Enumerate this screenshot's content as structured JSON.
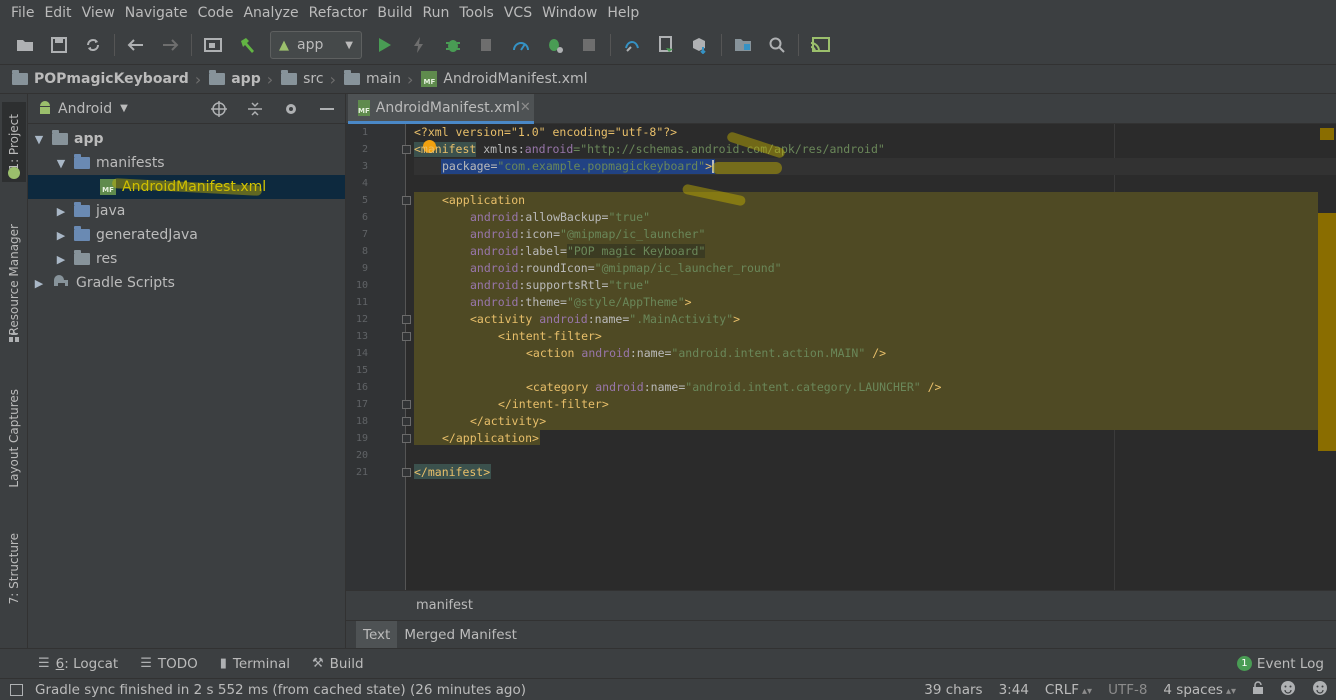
{
  "menu": [
    "File",
    "Edit",
    "View",
    "Navigate",
    "Code",
    "Analyze",
    "Refactor",
    "Build",
    "Run",
    "Tools",
    "VCS",
    "Window",
    "Help"
  ],
  "toolbar": {
    "run_config": "app"
  },
  "breadcrumb": {
    "project": "POPmagicKeyboard",
    "module": "app",
    "src": "src",
    "main": "main",
    "file": "AndroidManifest.xml"
  },
  "left_stripe": {
    "project": "1: Project",
    "resource_manager": "Resource Manager",
    "layout_captures": "Layout Captures",
    "structure": "7: Structure"
  },
  "project_panel": {
    "view_mode": "Android",
    "tree": {
      "app": "app",
      "manifests": "manifests",
      "manifest_file": "AndroidManifest.xml",
      "java": "java",
      "generated_java": "generatedJava",
      "res": "res",
      "gradle_scripts": "Gradle Scripts"
    }
  },
  "editor": {
    "tab_label": "AndroidManifest.xml",
    "line_numbers": [
      "1",
      "2",
      "3",
      "4",
      "5",
      "6",
      "7",
      "8",
      "9",
      "10",
      "11",
      "12",
      "13",
      "14",
      "15",
      "16",
      "17",
      "18",
      "19",
      "20",
      "21"
    ],
    "code": {
      "l1": "<?xml version=\"1.0\" encoding=\"utf-8\"?>",
      "l2_tag": "<manifest",
      "l2_ns": "xmlns:",
      "l2_attr": "android",
      "l2_val": "=\"http://schemas.android.com/apk/res/android\"",
      "l3_attr": "package=",
      "l3_val": "\"com.example.popmagickeyboard\"",
      "l3_end": ">",
      "l5": "<application",
      "l6_ns": "android",
      "l6_attr": ":allowBackup=",
      "l6_val": "\"true\"",
      "l7_ns": "android",
      "l7_attr": ":icon=",
      "l7_val": "\"@mipmap/ic_launcher\"",
      "l8_ns": "android",
      "l8_attr": ":label=",
      "l8_val": "\"POP magic Keyboard\"",
      "l9_ns": "android",
      "l9_attr": ":roundIcon=",
      "l9_val": "\"@mipmap/ic_launcher_round\"",
      "l10_ns": "android",
      "l10_attr": ":supportsRtl=",
      "l10_val": "\"true\"",
      "l11_ns": "android",
      "l11_attr": ":theme=",
      "l11_val": "\"@style/AppTheme\"",
      "l11_end": ">",
      "l12_tag": "<activity",
      "l12_ns": "android",
      "l12_attr": ":name=",
      "l12_val": "\".MainActivity\"",
      "l12_end": ">",
      "l13": "<intent-filter>",
      "l14_tag": "<action",
      "l14_ns": "android",
      "l14_attr": ":name=",
      "l14_val": "\"android.intent.action.MAIN\"",
      "l14_end": " />",
      "l16_tag": "<category",
      "l16_ns": "android",
      "l16_attr": ":name=",
      "l16_val": "\"android.intent.category.LAUNCHER\"",
      "l16_end": " />",
      "l17": "</intent-filter>",
      "l18": "</activity>",
      "l19": "</application>",
      "l21": "</manifest>"
    },
    "xml_breadcrumb": "manifest",
    "bottom_tabs": [
      "Text",
      "Merged Manifest"
    ]
  },
  "tool_windows": {
    "logcat_num": "6",
    "logcat": ": Logcat",
    "todo": "TODO",
    "terminal": "Terminal",
    "build": "Build",
    "event_log": "Event Log",
    "event_count": "1"
  },
  "status": {
    "message": "Gradle sync finished in 2 s 552 ms (from cached state) (26 minutes ago)",
    "chars": "39 chars",
    "position": "3:44",
    "line_sep": "CRLF",
    "encoding": "UTF-8",
    "indent": "4 spaces"
  },
  "colors": {
    "background": "#2b2b2b",
    "panel": "#3c3f41",
    "accent": "#4a88c7",
    "selection": "#0d293e",
    "highlight": "#4f4a24"
  }
}
